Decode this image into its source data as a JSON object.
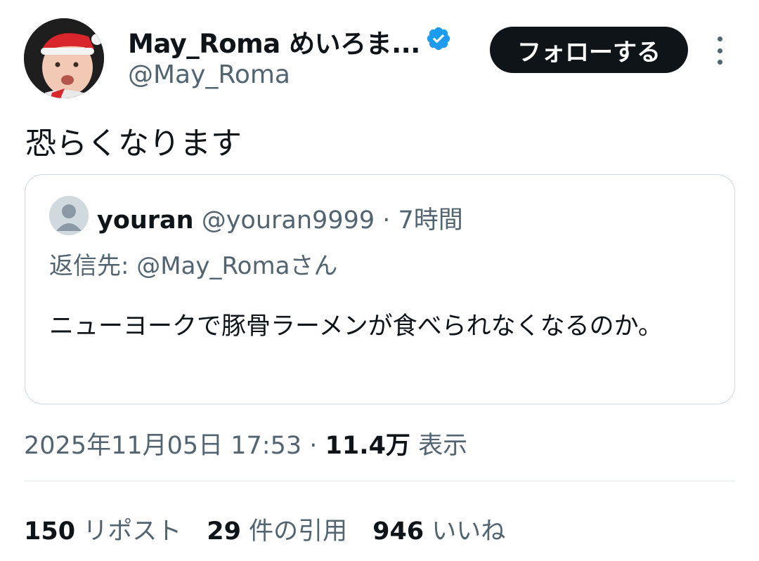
{
  "author": {
    "display_name": "May_Roma めいろま...",
    "handle": "@May_Roma"
  },
  "follow_button": {
    "label": "フォローする"
  },
  "tweet": {
    "text": "恐らくなります"
  },
  "quoted": {
    "name": "youran",
    "meta": "@youran9999 · 7時間",
    "reply_to": "返信先: @May_Romaさん",
    "text": "ニューヨークで豚骨ラーメンが食べられなくなるのか。"
  },
  "timestamp": {
    "datetime": "2025年11月05日 17:53",
    "separator": "·",
    "views": "11.4万",
    "views_label": "表示"
  },
  "stats": {
    "reposts": "150",
    "reposts_label": "リポスト",
    "quotes": "29",
    "quotes_label": "件の引用",
    "likes": "946",
    "likes_label": "いいね"
  },
  "colors": {
    "text_primary": "#0f1419",
    "text_secondary": "#536471",
    "border": "#cfd9de",
    "verified": "#1d9bf0",
    "follow_bg": "#0f1419"
  }
}
